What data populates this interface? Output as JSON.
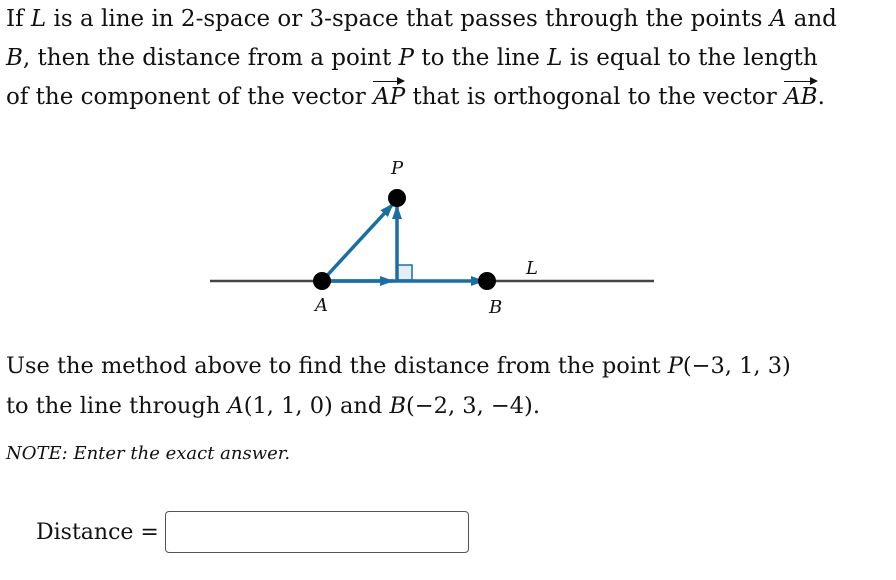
{
  "intro": {
    "line1": {
      "t1": "If ",
      "L": "L",
      "t2": " is a line in 2-space or 3-space that passes through the points ",
      "A": "A",
      "t3": " and"
    },
    "line2": {
      "B": "B",
      "t1": ", then the distance from a point ",
      "P": "P",
      "t2": " to the line ",
      "L": "L",
      "t3": " is equal to the length"
    },
    "line3": {
      "t1": "of the component of the vector ",
      "vecAP": "AP",
      "t2": " that is orthogonal to the vector ",
      "vecAB": "AB",
      "t3": "."
    }
  },
  "diagram": {
    "labels": {
      "P": "P",
      "A": "A",
      "B": "B",
      "L": "L"
    },
    "colors": {
      "vector": "#1a6ea3",
      "line": "#444444",
      "point": "#000000",
      "right_angle_fill": "#e3eef7"
    }
  },
  "problem": {
    "line1": {
      "t1": "Use the method above to find the distance from the point ",
      "P": "P",
      "Pcoords": "(−3, 1, 3)"
    },
    "line2": {
      "t1": "to the line through ",
      "A": "A",
      "Acoords": "(1, 1, 0)",
      "t2": " and ",
      "B": "B",
      "Bcoords": "(−2, 3, −4)",
      "t3": "."
    }
  },
  "note": "NOTE: Enter the exact answer.",
  "answer": {
    "label": "Distance =",
    "value": "",
    "placeholder": ""
  }
}
